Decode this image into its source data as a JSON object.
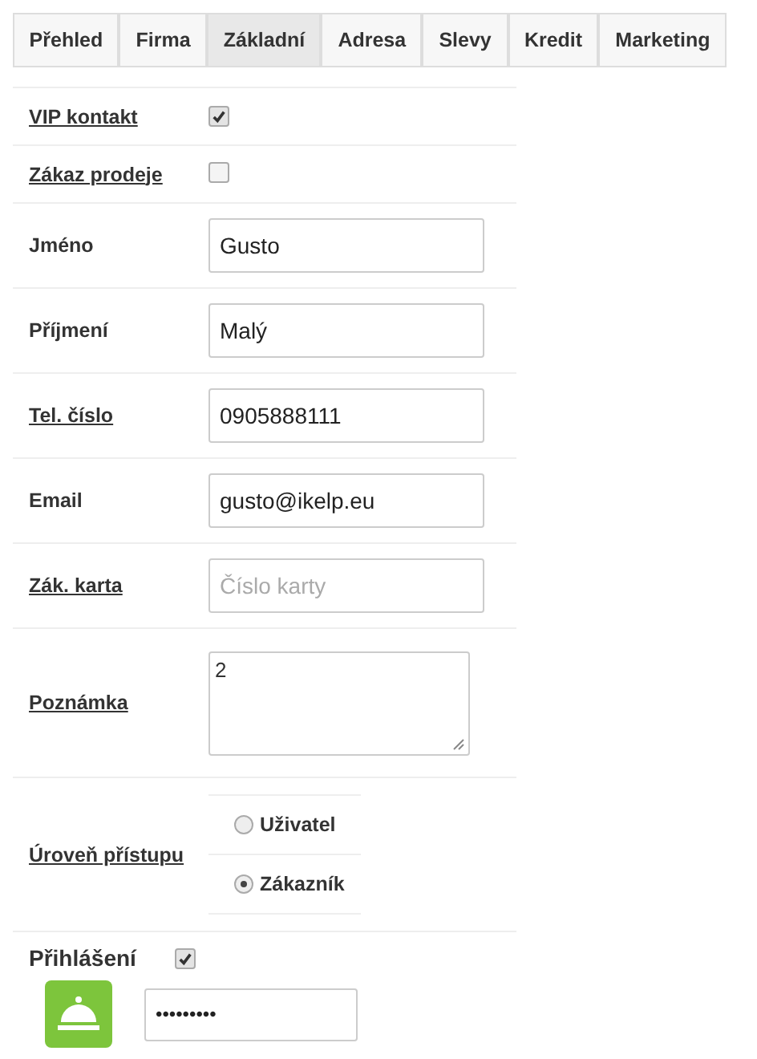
{
  "tabs": [
    {
      "label": "Přehled",
      "selected": false
    },
    {
      "label": "Firma",
      "selected": false
    },
    {
      "label": "Základní",
      "selected": true
    },
    {
      "label": "Adresa",
      "selected": false
    },
    {
      "label": "Slevy",
      "selected": false
    },
    {
      "label": "Kredit",
      "selected": false
    },
    {
      "label": "Marketing",
      "selected": false
    }
  ],
  "rows": [
    {
      "kind": "checkbox",
      "label": "VIP kontakt",
      "link": true,
      "checked": true
    },
    {
      "kind": "checkbox",
      "label": "Zákaz prodeje",
      "link": true,
      "checked": false
    },
    {
      "kind": "text",
      "label": "Jméno",
      "link": false,
      "value": "Gusto"
    },
    {
      "kind": "text",
      "label": "Příjmení",
      "link": false,
      "value": "Malý"
    },
    {
      "kind": "text",
      "label": "Tel. číslo",
      "link": true,
      "value": "0905888111"
    },
    {
      "kind": "text",
      "label": "Email",
      "link": false,
      "value": "gusto@ikelp.eu"
    },
    {
      "kind": "text",
      "label": "Zák. karta",
      "link": true,
      "placeholder": "Číslo karty"
    },
    {
      "kind": "textarea",
      "label": "Poznámka",
      "link": true,
      "value": "2"
    },
    {
      "kind": "radio",
      "label": "Úroveň přístupu",
      "link": true,
      "options": [
        {
          "label": "Uživatel",
          "selected": false
        },
        {
          "label": "Zákazník",
          "selected": true
        }
      ]
    }
  ],
  "login": {
    "label": "Přihlášení",
    "checked": true,
    "password": "•••••••••"
  }
}
